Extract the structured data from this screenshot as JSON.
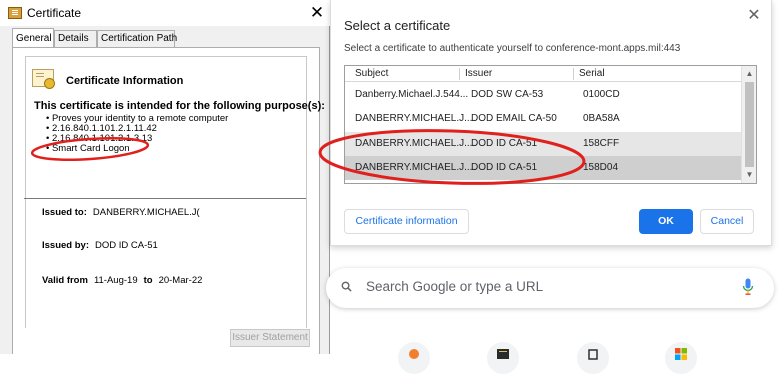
{
  "cert_window": {
    "title": "Certificate",
    "tabs": [
      {
        "label": "General",
        "active": true
      },
      {
        "label": "Details",
        "active": false
      },
      {
        "label": "Certification Path",
        "active": false
      }
    ],
    "info_heading": "Certificate Information",
    "purpose_heading": "This certificate is intended for the following purpose(s):",
    "purposes": [
      "Proves your identity to a remote computer",
      "2.16.840.1.101.2.1.11.42",
      "2.16.840.1.101.2.1.3.13",
      "Smart Card Logon"
    ],
    "issued_to_label": "Issued to:",
    "issued_to_value": "DANBERRY.MICHAEL.J(",
    "issued_by_label": "Issued by:",
    "issued_by_value": "DOD ID CA-51",
    "valid_from_label": "Valid from",
    "valid_from_value": "11-Aug-19",
    "valid_to_label": "to",
    "valid_to_value": "20-Mar-22",
    "issuer_statement_label": "Issuer Statement"
  },
  "select_dialog": {
    "title": "Select a certificate",
    "subtitle": "Select a certificate to authenticate yourself to conference-mont.apps.mil:443",
    "columns": [
      "Subject",
      "Issuer",
      "Serial"
    ],
    "rows": [
      {
        "subject": "Danberry.Michael.J.544...",
        "issuer": "DOD SW CA-53",
        "serial": "0100CD"
      },
      {
        "subject": "DANBERRY.MICHAEL.J....",
        "issuer": "DOD EMAIL CA-50",
        "serial": "0BA58A"
      },
      {
        "subject": "DANBERRY.MICHAEL.J....",
        "issuer": "DOD ID CA-51",
        "serial": "158CFF"
      },
      {
        "subject": "DANBERRY.MICHAEL.J....",
        "issuer": "DOD ID CA-51",
        "serial": "158D04"
      }
    ],
    "cert_info_button": "Certificate information",
    "ok_button": "OK",
    "cancel_button": "Cancel"
  },
  "newtab": {
    "search_placeholder": "Search Google or type a URL"
  },
  "colors": {
    "chrome_blue": "#1a73e8",
    "annotation_red": "#e0201c"
  }
}
